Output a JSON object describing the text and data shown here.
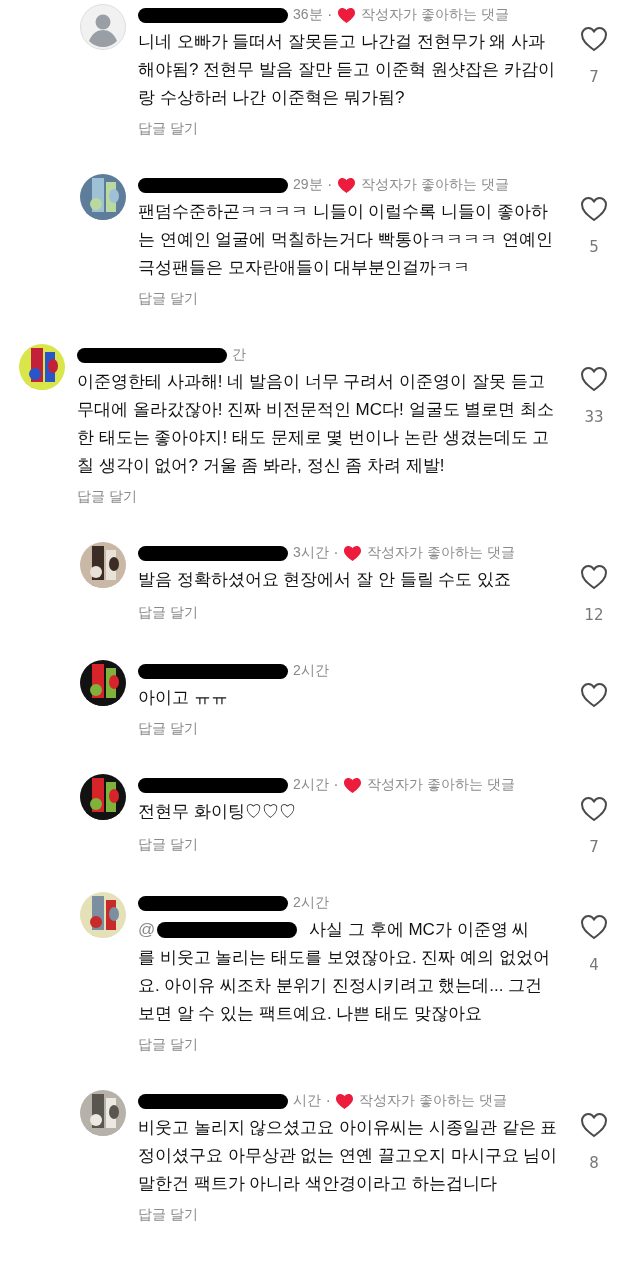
{
  "earlier_replies": [
    {
      "avatar": {
        "kind": "default"
      },
      "redacted": true,
      "time": "36분",
      "dot": "·",
      "author_badge": "작성자가 좋아하는 댓글",
      "text": "니네 오빠가 들떠서 잘못듣고 나간걸 전현무가 왜 사과해야됨? 전현무 발음 잘만 듣고 이준혁 원샷잡은 카감이랑 수상하러 나간 이준혁은 뭐가됨?",
      "reply_link": "답글 달기",
      "liked": false,
      "likes": "7"
    },
    {
      "redacted": true,
      "time": "29분",
      "dot": "·",
      "author_badge": "작성자가 좋아하는 댓글",
      "text": "팬덤수준하곤ㅋㅋㅋㅋ 니들이 이럴수록 니들이 좋아하는 연예인 얼굴에 먹칠하는거다 빡통아ㅋㅋㅋㅋ 연예인 극성팬들은 모자란애들이 대부분인걸까ㅋㅋ",
      "reply_link": "답글 달기",
      "liked": false,
      "likes": "5"
    }
  ],
  "comment": {
    "redacted": true,
    "time": "간",
    "text": "이준영한테 사과해! 네 발음이 너무 구려서 이준영이 잘못 듣고 무대에 올라갔잖아! 진짜 비전문적인 MC다! 얼굴도 별로면 최소한 태도는 좋아야지! 태도 문제로 몇 번이나 논란 생겼는데도 고칠 생각이 없어? 거울 좀 봐라, 정신 좀 차려 제발!",
    "reply_link": "답글 달기",
    "liked": false,
    "likes": "33",
    "replies": [
      {
        "redacted": true,
        "time": "3시간",
        "dot": "·",
        "author_badge": "작성자가 좋아하는 댓글",
        "text": "발음 정확하셨어요 현장에서 잘 안 들릴 수도 있죠",
        "reply_link": "답글 달기",
        "liked": false,
        "likes": "12"
      },
      {
        "redacted": true,
        "time": "2시간",
        "text": "아이고 ㅠㅠ",
        "reply_link": "답글 달기",
        "liked": false
      },
      {
        "redacted": true,
        "time": "2시간",
        "dot": "·",
        "author_badge": "작성자가 좋아하는 댓글",
        "text": "전현무 화이팅♡♡♡",
        "reply_link": "답글 달기",
        "liked": false,
        "likes": "7"
      },
      {
        "redacted": true,
        "time": "2시간",
        "mention": "@",
        "mention_redacted": true,
        "text_lead": "사실 그 후에 MC가 이준영 씨",
        "text": "를 비웃고 놀리는 태도를 보였잖아요. 진짜 예의 없었어요. 아이유 씨조차 분위기 진정시키려고 했는데... 그건 보면 알 수 있는 팩트예요. 나쁜 태도 맞잖아요",
        "reply_link": "답글 달기",
        "liked": false,
        "likes": "4"
      },
      {
        "redacted": true,
        "time": "시간",
        "dot": "·",
        "author_badge": "작성자가 좋아하는 댓글",
        "text": "비웃고 놀리지 않으셨고요 아이유씨는 시종일관 같은 표정이셨구요 아무상관 없는 연옌 끌고오지 마시구요 님이 말한건 팩트가 아니라 색안경이라고 하는겁니다",
        "reply_link": "답글 달기",
        "liked": false,
        "likes": "8"
      }
    ]
  }
}
